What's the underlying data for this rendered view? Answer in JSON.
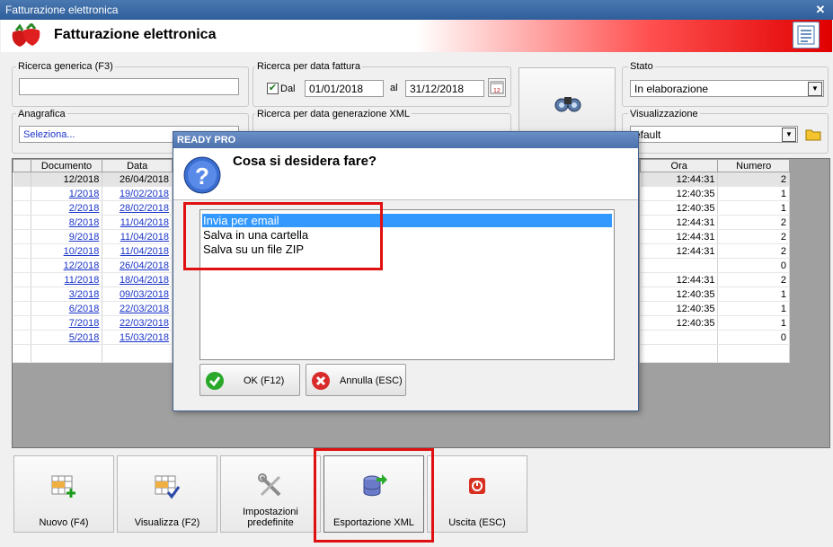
{
  "window": {
    "title": "Fatturazione elettronica"
  },
  "header": {
    "title": "Fatturazione elettronica"
  },
  "filters": {
    "generic_label": "Ricerca generica (F3)",
    "generic_value": "",
    "date_invoice_label": "Ricerca per data fattura",
    "dal_label": "Dal",
    "date_from": "01/01/2018",
    "al_label": "al",
    "date_to": "31/12/2018",
    "date_xml_label": "Ricerca per data generazione XML",
    "anagrafica_label": "Anagrafica",
    "anagrafica_value": "Seleziona...",
    "stato_label": "Stato",
    "stato_value": "In elaborazione",
    "visualizzazione_label": "Visualizzazione",
    "visualizzazione_value": "efault"
  },
  "grid": {
    "columns": [
      "Documento",
      "Data",
      "Ora",
      "Numero"
    ],
    "rows": [
      {
        "doc": "12/2018",
        "date": "26/04/2018",
        "time": "12:44:31",
        "num": "2"
      },
      {
        "doc": "1/2018",
        "date": "19/02/2018",
        "time": "12:40:35",
        "num": "1"
      },
      {
        "doc": "2/2018",
        "date": "28/02/2018",
        "time": "12:40:35",
        "num": "1"
      },
      {
        "doc": "8/2018",
        "date": "11/04/2018",
        "time": "12:44:31",
        "num": "2"
      },
      {
        "doc": "9/2018",
        "date": "11/04/2018",
        "time": "12:44:31",
        "num": "2"
      },
      {
        "doc": "10/2018",
        "date": "11/04/2018",
        "time": "12:44:31",
        "num": "2"
      },
      {
        "doc": "12/2018",
        "date": "26/04/2018",
        "time": "",
        "num": "0"
      },
      {
        "doc": "11/2018",
        "date": "18/04/2018",
        "time": "12:44:31",
        "num": "2"
      },
      {
        "doc": "3/2018",
        "date": "09/03/2018",
        "time": "12:40:35",
        "num": "1"
      },
      {
        "doc": "6/2018",
        "date": "22/03/2018",
        "time": "12:40:35",
        "num": "1"
      },
      {
        "doc": "7/2018",
        "date": "22/03/2018",
        "time": "12:40:35",
        "num": "1"
      },
      {
        "doc": "5/2018",
        "date": "15/03/2018",
        "time": "",
        "num": "0"
      }
    ]
  },
  "toolbar": {
    "nuovo": "Nuovo (F4)",
    "visualizza": "Visualizza (F2)",
    "impostazioni_1": "Impostazioni",
    "impostazioni_2": "predefinite",
    "esportazione": "Esportazione XML",
    "uscita": "Uscita (ESC)"
  },
  "dialog": {
    "title": "READY PRO",
    "question": "Cosa si desidera fare?",
    "options": [
      "Invia per email",
      "Salva in una cartella",
      "Salva su un file ZIP"
    ],
    "ok_label": "OK (F12)",
    "cancel_label": "Annulla (ESC)"
  },
  "colors": {
    "accent": "#3399ff",
    "highlight": "#e01010",
    "header_red": "#e00000"
  }
}
